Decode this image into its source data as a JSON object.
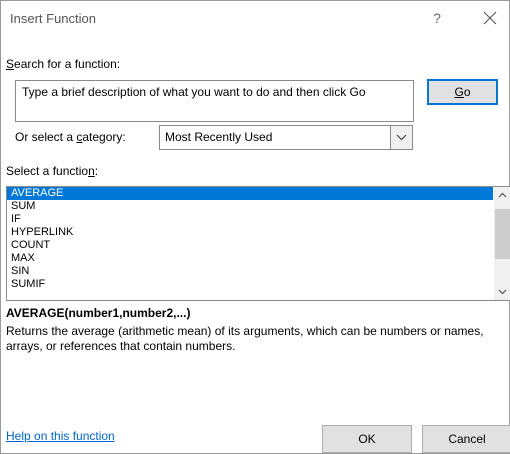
{
  "window": {
    "title": "Insert Function",
    "help_glyph": "?"
  },
  "search": {
    "label_prefix": "",
    "label_accel": "S",
    "label_rest": "earch for a function:",
    "text": "Type a brief description of what you want to do and then click Go",
    "go_accel": "G",
    "go_rest": "o"
  },
  "category": {
    "label_before": "Or select a ",
    "label_accel": "c",
    "label_after": "ategory:",
    "value": "Most Recently Used"
  },
  "functions": {
    "label_before": "Select a functio",
    "label_accel": "n",
    "label_after": ":",
    "items": [
      "AVERAGE",
      "SUM",
      "IF",
      "HYPERLINK",
      "COUNT",
      "MAX",
      "SIN",
      "SUMIF"
    ],
    "selected_index": 0
  },
  "detail": {
    "syntax": "AVERAGE(number1,number2,...)",
    "description": "Returns the average (arithmetic mean) of its arguments, which can be numbers or names, arrays, or references that contain numbers."
  },
  "footer": {
    "help_link": "Help on this function",
    "ok_label": "OK",
    "cancel_label": "Cancel"
  }
}
